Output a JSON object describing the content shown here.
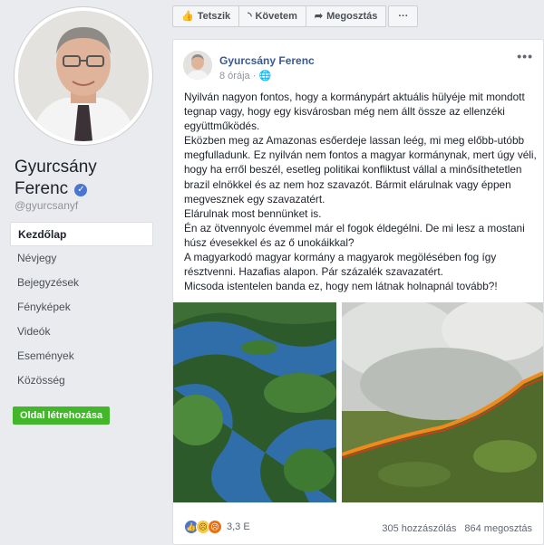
{
  "page": {
    "name_line1": "Gyurcsány",
    "name_line2": "Ferenc",
    "handle": "@gyurcsanyf"
  },
  "nav": {
    "items": [
      {
        "label": "Kezdőlap",
        "active": true
      },
      {
        "label": "Névjegy"
      },
      {
        "label": "Bejegyzések"
      },
      {
        "label": "Fényképek"
      },
      {
        "label": "Videók"
      },
      {
        "label": "Események"
      },
      {
        "label": "Közösség"
      }
    ],
    "create_page_label": "Oldal létrehozása"
  },
  "actions": {
    "like_label": "Tetszik",
    "follow_label": "Követem",
    "share_label": "Megosztás",
    "more_label": "···"
  },
  "post": {
    "author": "Gyurcsány Ferenc",
    "time": "8 órája",
    "more_label": "•••",
    "paragraphs": [
      "Nyilván nagyon fontos, hogy a kormánypárt aktuális hülyéje mit mondott tegnap vagy, hogy egy kisvárosban még nem állt össze az ellenzéki együttműködés.",
      "Eközben meg az Amazonas esőerdeje lassan leég, mi meg előbb-utóbb megfulladunk. Ez nyilván nem fontos a magyar kormánynak, mert úgy véli, hogy ha erről beszél, esetleg politikai konfliktust vállal a minősíthetetlen brazil elnökkel és az nem hoz szavazót. Bármit elárulnak vagy éppen megvesznek egy szavazatért.",
      "Elárulnak most bennünket is.",
      "Én az ötvennyolc évemmel már el fogok éldegélni. De mi lesz a mostani húsz évesekkel és az ő unokáikkal?",
      "A magyarkodó magyar kormány a magyarok megölésében fog így résztvenni. Hazafias alapon. Pár százalék szavazatért.",
      "Micsoda istentelen banda ez, hogy nem látnak holnapnál tovább?!"
    ],
    "reactions_count": "3,3 E",
    "comments": "305 hozzászólás",
    "shares": "864 megosztás"
  },
  "colors": {
    "link": "#365899",
    "green": "#42b72a",
    "like": "#4a76d1"
  }
}
